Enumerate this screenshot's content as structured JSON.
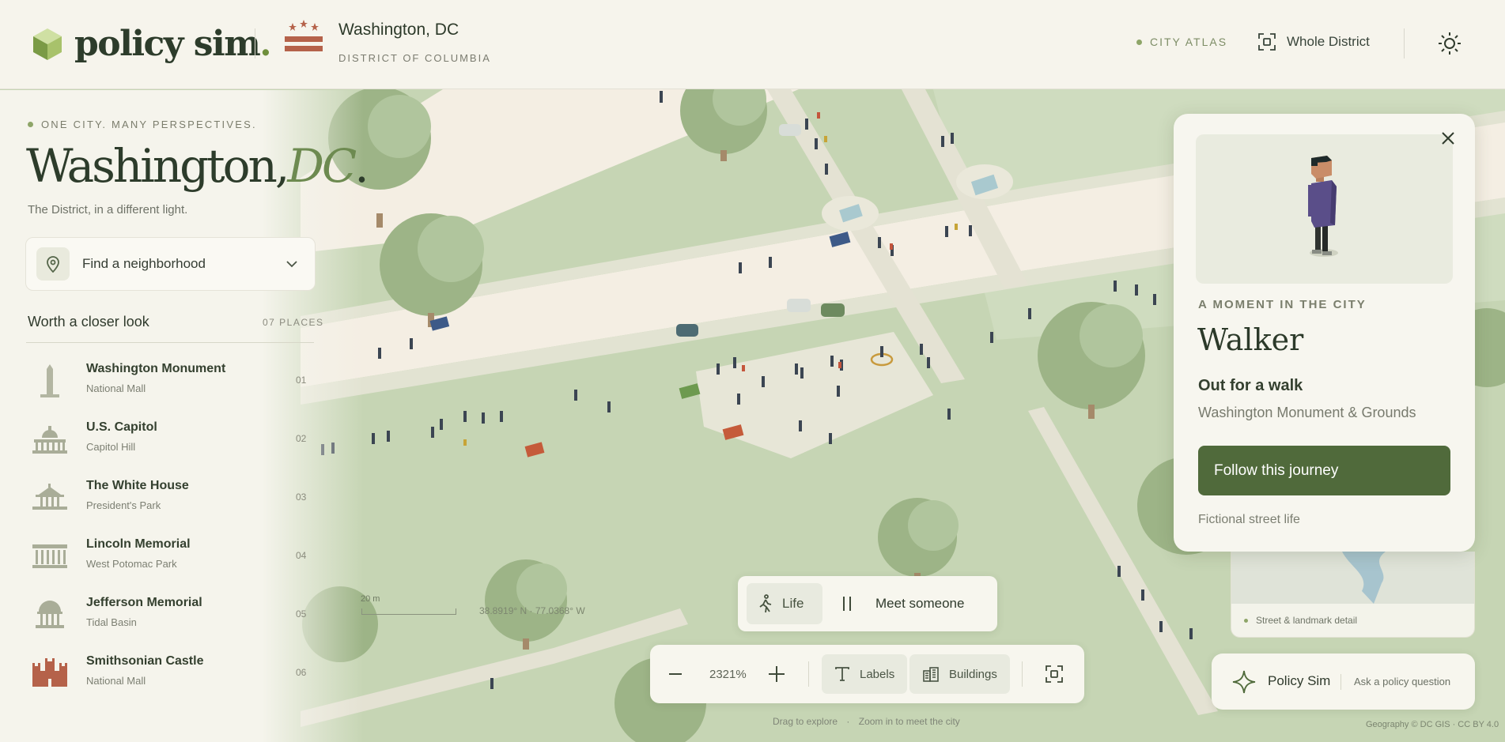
{
  "header": {
    "logo_text": "policy sim",
    "logo_dot": ".",
    "city_title": "Washington, DC",
    "city_subtitle": "DISTRICT OF COLUMBIA",
    "atlas_label": "CITY ATLAS",
    "scope_label": "Whole District",
    "theme_icon": "sun-icon"
  },
  "sidebar": {
    "tagline": "ONE CITY. MANY PERSPECTIVES.",
    "title_main": "Washington,",
    "title_accent": "DC",
    "title_dot": ".",
    "description": "The District, in a different light.",
    "search": {
      "label": "Find a neighborhood",
      "icon": "map-pin-icon"
    },
    "list_title": "Worth a closer look",
    "places_count": "07 PLACES",
    "landmarks": [
      {
        "name": "Washington Monument",
        "area": "National Mall",
        "num": "01",
        "icon": "obelisk-icon"
      },
      {
        "name": "U.S. Capitol",
        "area": "Capitol Hill",
        "num": "02",
        "icon": "capitol-icon"
      },
      {
        "name": "The White House",
        "area": "President's Park",
        "num": "03",
        "icon": "white-house-icon"
      },
      {
        "name": "Lincoln Memorial",
        "area": "West Potomac Park",
        "num": "04",
        "icon": "memorial-icon"
      },
      {
        "name": "Jefferson Memorial",
        "area": "Tidal Basin",
        "num": "05",
        "icon": "dome-icon"
      },
      {
        "name": "Smithsonian Castle",
        "area": "National Mall",
        "num": "06",
        "icon": "castle-icon"
      }
    ]
  },
  "card": {
    "eyebrow": "A MOMENT IN THE CITY",
    "title": "Walker",
    "activity": "Out for a walk",
    "location": "Washington Monument & Grounds",
    "cta": "Follow this journey",
    "footnote": "Fictional street life",
    "minimap_label": "Street & landmark detail"
  },
  "life_bar": {
    "life_label": "Life",
    "meet_label": "Meet someone"
  },
  "zoom_bar": {
    "zoom": "2321%",
    "labels": "Labels",
    "buildings": "Buildings"
  },
  "hint": {
    "left": "Drag to explore",
    "sep": "·",
    "right": "Zoom in to meet the city"
  },
  "policy": {
    "name": "Policy Sim",
    "ask": "Ask a policy question"
  },
  "map": {
    "scale_label": "20 m",
    "coords": "38.8919° N · 77.0368° W",
    "credit": "Geography © DC GIS · CC BY 4.0"
  },
  "colors": {
    "accent": "#506a3b",
    "brand_green": "#6f8f3c",
    "flag_red": "#b5624a",
    "map_green": "#c5d4b3",
    "path": "#f5efe4"
  }
}
